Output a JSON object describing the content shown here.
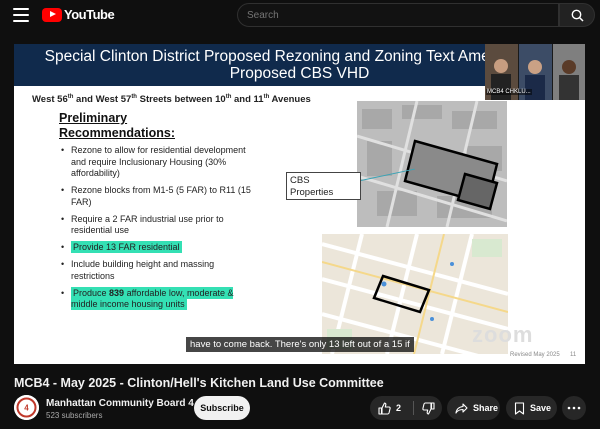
{
  "header": {
    "logo_text": "YouTube",
    "search_placeholder": "Search"
  },
  "slide": {
    "title_line1": "Special Clinton District Proposed Rezoning and Zoning Text Amendments-",
    "title_line2": "Proposed CBS VHD",
    "subtitle_part1": "West 56",
    "subtitle_sup1": "th",
    "subtitle_part2": " and West 57",
    "subtitle_sup2": "th",
    "subtitle_part3": " Streets between 10",
    "subtitle_sup3": "th",
    "subtitle_part4": " and 11",
    "subtitle_sup4": "th",
    "subtitle_part5": " Avenues",
    "recommendations_title_line1": "Preliminary",
    "recommendations_title_line2": "Recommendations:",
    "bullets": [
      "Rezone to allow for residential development and require Inclusionary Housing (30% affordability)",
      "Rezone blocks from M1-5 (5 FAR) to R11 (15 FAR)",
      "Require a 2 FAR industrial use prior to residential use",
      "Provide 13 FAR residential",
      "Include building height and massing restrictions"
    ],
    "last_bullet_before": "Produce ",
    "last_bullet_bold": "839",
    "last_bullet_after": " affordable low, moderate & middle income housing units",
    "cbs_label_line1": "CBS",
    "cbs_label_line2": "Properties",
    "watermark": "zoom",
    "revised": "Revised May 2025",
    "page_number": "11",
    "caption": "have to come back. There's only 13 left out of a 15 if",
    "participant_label": "MCB4 CHKLU..."
  },
  "video": {
    "title": "MCB4 - May 2025 - Clinton/Hell's Kitchen Land Use Committee"
  },
  "channel": {
    "name": "Manhattan Community Board 4",
    "subscribers": "523 subscribers",
    "subscribe_label": "Subscribe"
  },
  "actions": {
    "like_count": "2",
    "share_label": "Share",
    "save_label": "Save"
  },
  "colors": {
    "youtube_red": "#ff0000",
    "slide_header": "#102a4c",
    "highlight": "#34e0b4"
  }
}
